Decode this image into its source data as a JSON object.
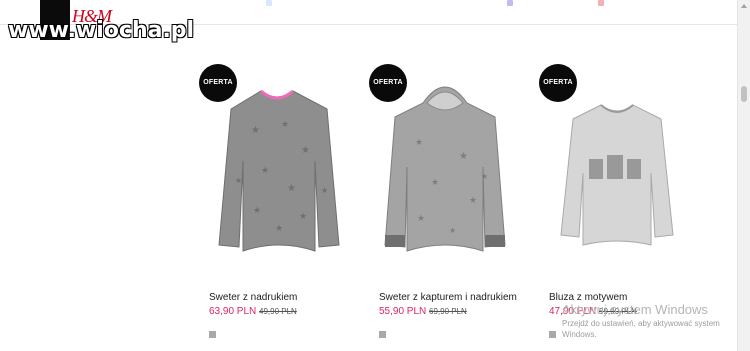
{
  "watermark": "www.wiocha.pl",
  "header": {
    "logo": "H&M"
  },
  "badge_label": "OFERTA",
  "products": [
    {
      "title": "Sweter z nadrukiem",
      "price": "63,90 PLN",
      "old_price": "49,90 PLN"
    },
    {
      "title": "Sweter z kapturem i nadrukiem",
      "price": "55,90 PLN",
      "old_price": "69,90 PLN"
    },
    {
      "title": "Bluza z motywem",
      "price": "47,90 PLN",
      "old_price": "59,90 PLN"
    }
  ],
  "windows_notice": {
    "title": "Aktywuj system Windows",
    "subtitle": "Przejdź do ustawień, aby aktywować system Windows."
  },
  "colors": {
    "accent_price": "#e0245e",
    "badge_bg": "#0a0a0a",
    "brand_red": "#d0021b"
  },
  "icons": [
    "scroll-up-icon",
    "color-swatch"
  ]
}
